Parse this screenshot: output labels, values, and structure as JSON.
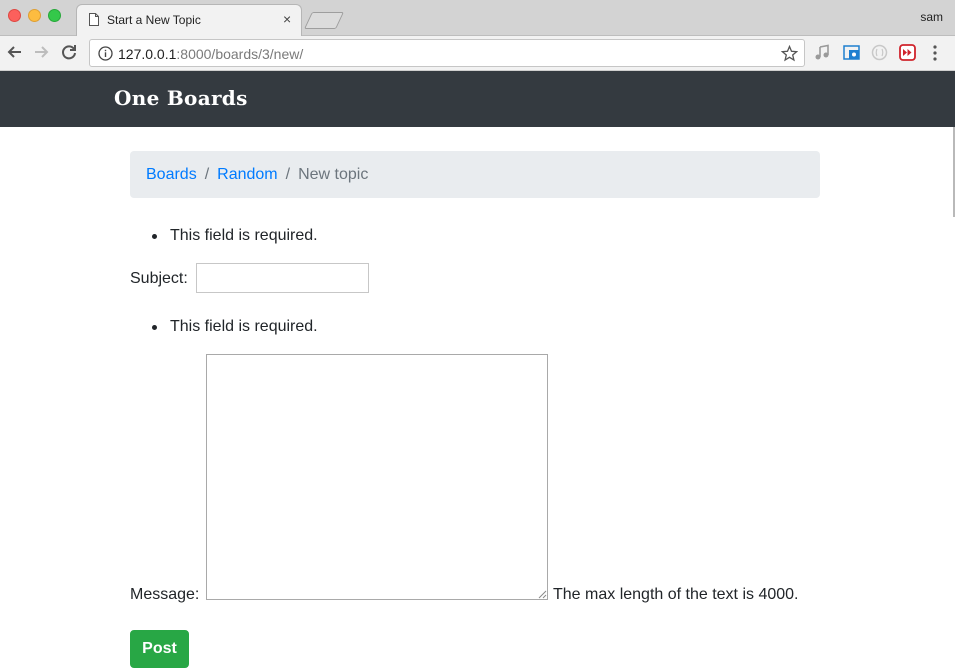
{
  "browser": {
    "tab_title": "Start a New Topic",
    "tab_close": "×",
    "profile_name": "sam",
    "url_host": "127.0.0.1",
    "url_path": ":8000/boards/3/new/"
  },
  "navbar": {
    "brand": "One Boards"
  },
  "breadcrumb": {
    "items": [
      {
        "label": "Boards"
      },
      {
        "label": "Random"
      }
    ],
    "separator": "/",
    "active": "New topic"
  },
  "form": {
    "subject_error": "This field is required.",
    "subject_label": "Subject:",
    "subject_value": "",
    "message_error": "This field is required.",
    "message_label": "Message:",
    "message_value": "",
    "message_help": "The max length of the text is 4000.",
    "submit_label": "Post"
  },
  "colors": {
    "navbar_bg": "#343a40",
    "link": "#007bff",
    "breadcrumb_bg": "#e9ecef",
    "post_button": "#28a745"
  }
}
